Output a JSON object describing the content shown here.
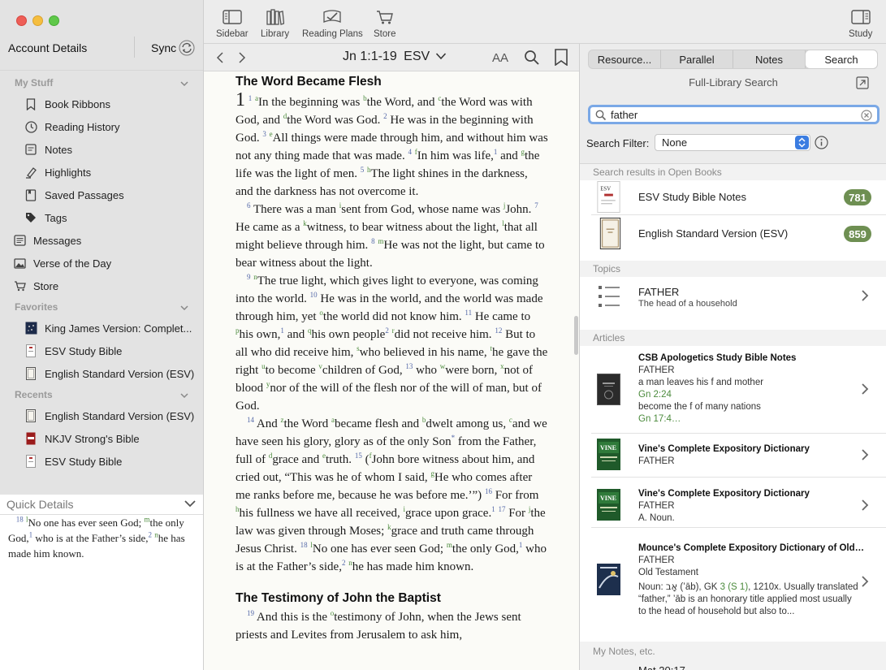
{
  "sidebar": {
    "account": "Account Details",
    "sync": "Sync",
    "my_stuff_title": "My Stuff",
    "my_stuff": [
      "Book Ribbons",
      "Reading History",
      "Notes",
      "Highlights",
      "Saved Passages",
      "Tags"
    ],
    "top_items": [
      "Messages",
      "Verse of the Day",
      "Store"
    ],
    "favorites_title": "Favorites",
    "favorites": [
      "King James Version: Complet...",
      "ESV Study Bible",
      "English Standard Version (ESV)"
    ],
    "recents_title": "Recents",
    "recents": [
      "English Standard Version (ESV)",
      "NKJV Strong's Bible",
      "ESV Study Bible"
    ],
    "quick_details_title": "Quick Details",
    "quick_details": {
      "v": "18",
      "fn1": "l",
      "t1": "No one has ever seen God; ",
      "fn2": "m",
      "t2": "the only God,",
      "fn3": "1",
      "t3": " who is at the Father’s side,",
      "fn4": "2",
      "fn5": "n",
      "t4": "he has made him known."
    }
  },
  "toolbar": {
    "sidebar": "Sidebar",
    "library": "Library",
    "reading_plans": "Reading Plans",
    "store": "Store",
    "study": "Study"
  },
  "reader": {
    "reference": "Jn 1:1-19",
    "version": "ESV",
    "font_btn": "AA",
    "heading1": "The Word Became Flesh",
    "heading2": "The Testimony of John the Baptist"
  },
  "panel": {
    "tabs": [
      "Resource...",
      "Parallel",
      "Notes",
      "Search"
    ],
    "title": "Full-Library Search",
    "search_value": "father",
    "filter_label": "Search Filter:",
    "filter_value": "None",
    "open_books_header": "Search results in Open Books",
    "open_books": [
      {
        "title": "ESV Study Bible Notes",
        "count": "781"
      },
      {
        "title": "English Standard Version (ESV)",
        "count": "859"
      }
    ],
    "topics_header": "Topics",
    "topic": {
      "title": "FATHER",
      "sub": "The head of a household"
    },
    "articles_header": "Articles",
    "articles": [
      {
        "title": "CSB Apologetics Study Bible Notes",
        "l1": "FATHER",
        "l2": "a man leaves his f and mother",
        "r1": "Gn 2:24",
        "l3": "become the f of many nations",
        "r2": "Gn 17:4…"
      },
      {
        "title": "Vine's Complete Expository Dictionary",
        "l1": "FATHER"
      },
      {
        "title": "Vine's Complete Expository Dictionary",
        "l1": "FATHER",
        "l2": "A. Noun."
      },
      {
        "title": "Mounce's Complete Expository Dictionary of Old and N...",
        "l1": "FATHER",
        "l2": "Old Testament",
        "l3a": "Noun: ",
        "heb": "אָב",
        "l3b": " (’āb), GK ",
        "gk": "3 (S 1)",
        "l3c": ", 1210x. Usually translated",
        "l4": "“father,” ’āb is an honorary title applied most usually",
        "l5": "to the head of household but also to..."
      }
    ],
    "my_notes_header": "My Notes, etc.",
    "my_notes_peek": "Mat 20:17"
  },
  "colors": {
    "badge": "#6e8f52",
    "focus": "#7aa8e6",
    "footnote": "#5468a8",
    "crossref": "#4b8a3c"
  }
}
